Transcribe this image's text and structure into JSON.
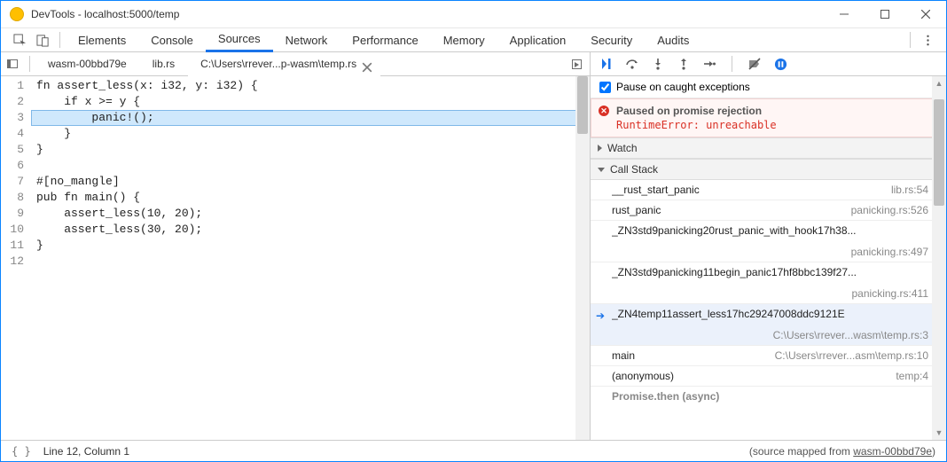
{
  "window": {
    "title": "DevTools - localhost:5000/temp"
  },
  "mainTabs": [
    "Elements",
    "Console",
    "Sources",
    "Network",
    "Performance",
    "Memory",
    "Application",
    "Security",
    "Audits"
  ],
  "fileTabs": {
    "t0": "wasm-00bbd79e",
    "t1": "lib.rs",
    "t2": "C:\\Users\\rrever...p-wasm\\temp.rs"
  },
  "code": {
    "l1": "fn assert_less(x: i32, y: i32) {",
    "l2": "    if x >= y {",
    "l3": "        panic!();",
    "l4": "    }",
    "l5": "}",
    "l6": "",
    "l7": "#[no_mangle]",
    "l8": "pub fn main() {",
    "l9": "    assert_less(10, 20);",
    "l10": "    assert_less(30, 20);",
    "l11": "}",
    "l12": ""
  },
  "lineNumbers": {
    "n1": "1",
    "n2": "2",
    "n3": "3",
    "n4": "4",
    "n5": "5",
    "n6": "6",
    "n7": "7",
    "n8": "8",
    "n9": "9",
    "n10": "10",
    "n11": "11",
    "n12": "12"
  },
  "debugger": {
    "pauseOnCaught": "Pause on caught exceptions",
    "pausedTitle": "Paused on promise rejection",
    "pausedMsg": "RuntimeError: unreachable",
    "watch": "Watch",
    "callstack": "Call Stack",
    "async": "Promise.then (async)",
    "frames": {
      "f0": {
        "fn": "__rust_start_panic",
        "loc": "lib.rs:54"
      },
      "f1": {
        "fn": "rust_panic",
        "loc": "panicking.rs:526"
      },
      "f2": {
        "fn": "_ZN3std9panicking20rust_panic_with_hook17h38...",
        "loc": "panicking.rs:497"
      },
      "f3": {
        "fn": "_ZN3std9panicking11begin_panic17hf8bbc139f27...",
        "loc": "panicking.rs:411"
      },
      "f4": {
        "fn": "_ZN4temp11assert_less17hc29247008ddc9121E",
        "loc": "C:\\Users\\rrever...wasm\\temp.rs:3"
      },
      "f5": {
        "fn": "main",
        "loc": "C:\\Users\\rrever...asm\\temp.rs:10"
      },
      "f6": {
        "fn": "(anonymous)",
        "loc": "temp:4"
      }
    }
  },
  "status": {
    "pos": "Line 12, Column 1",
    "mapPrefix": "(source mapped from ",
    "mapLink": "wasm-00bbd79e",
    "mapSuffix": ")"
  }
}
